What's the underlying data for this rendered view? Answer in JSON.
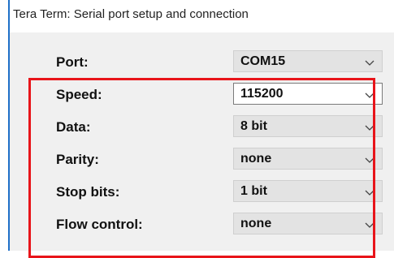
{
  "window": {
    "title": "Tera Term: Serial port setup and connection"
  },
  "settings": [
    {
      "label": "Port:",
      "value": "COM15"
    },
    {
      "label": "Speed:",
      "value": "115200"
    },
    {
      "label": "Data:",
      "value": "8 bit"
    },
    {
      "label": "Parity:",
      "value": "none"
    },
    {
      "label": "Stop bits:",
      "value": "1 bit"
    },
    {
      "label": "Flow control:",
      "value": "none"
    }
  ],
  "colors": {
    "highlight": "#e8141a",
    "accent": "#1f70c8",
    "dialog_background": "#f0f0f0"
  },
  "icons": {
    "dropdown": "chevron-down-icon"
  }
}
